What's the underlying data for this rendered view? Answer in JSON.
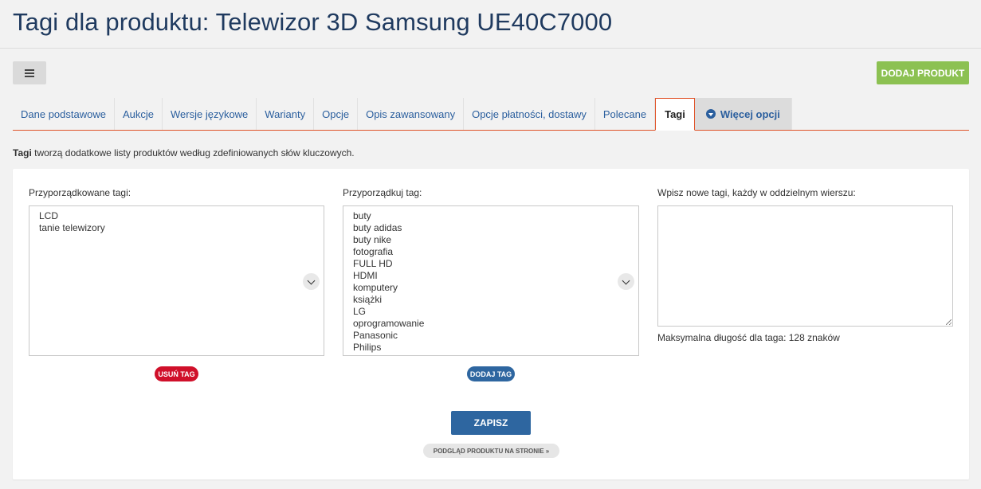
{
  "title": "Tagi dla produktu: Telewizor 3D Samsung UE40C7000",
  "menu_icon": "hamburger-icon",
  "add_product_label": "DODAJ PRODUKT",
  "tabs": [
    {
      "label": "Dane podstawowe",
      "active": false
    },
    {
      "label": "Aukcje",
      "active": false
    },
    {
      "label": "Wersje językowe",
      "active": false
    },
    {
      "label": "Warianty",
      "active": false
    },
    {
      "label": "Opcje",
      "active": false
    },
    {
      "label": "Opis zawansowany",
      "active": false
    },
    {
      "label": "Opcje płatności, dostawy",
      "active": false
    },
    {
      "label": "Polecane",
      "active": false
    },
    {
      "label": "Tagi",
      "active": true
    },
    {
      "label": "Więcej opcji",
      "active": false,
      "icon": "circle-chevron-down-icon"
    }
  ],
  "description": {
    "bold": "Tagi",
    "rest": " tworzą dodatkowe listy produktów według zdefiniowanych słów kluczowych."
  },
  "assigned": {
    "label": "Przyporządkowane tagi:",
    "items": [
      "LCD",
      "tanie telewizory"
    ],
    "button": "USUŃ TAG"
  },
  "assign": {
    "label": "Przyporządkuj tag:",
    "items": [
      "buty",
      "buty adidas",
      "buty nike",
      "fotografia",
      "FULL HD",
      "HDMI",
      "komputery",
      "książki",
      "LG",
      "oprogramowanie",
      "Panasonic",
      "Philips"
    ],
    "button": "DODAJ TAG"
  },
  "new_tags": {
    "label": "Wpisz nowe tagi, każdy w oddzielnym wierszu:",
    "value": "",
    "note": "Maksymalna długość dla taga: 128 znaków"
  },
  "save_label": "ZAPISZ",
  "preview_label": "PODGLĄD PRODUKTU NA STRONIE »",
  "colors": {
    "accent_green": "#8cc152",
    "primary_blue": "#2e66a0",
    "danger_red": "#d0102a",
    "tab_active_border": "#e0552b",
    "title_color": "#1f3a5f"
  }
}
